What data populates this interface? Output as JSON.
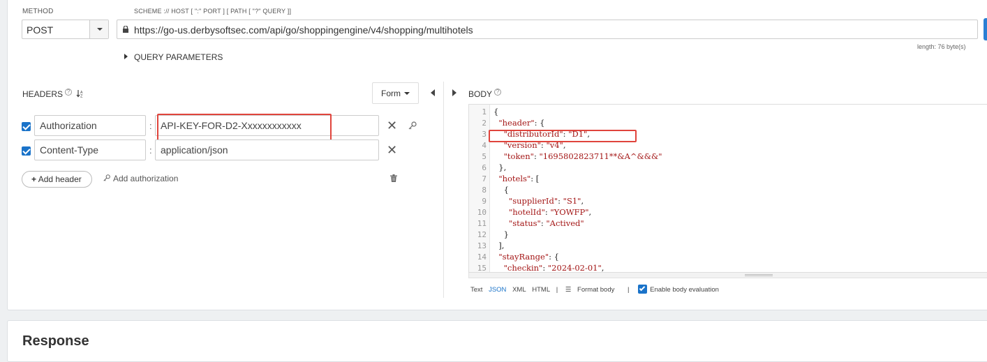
{
  "request": {
    "method_label": "METHOD",
    "method_value": "POST",
    "url_label": "SCHEME :// HOST [ \":\" PORT ] [ PATH [ \"?\" QUERY ]]",
    "url_value": "https://go-us.derbysoftsec.com/api/go/shoppingengine/v4/shopping/multihotels",
    "query_parameters_label": "QUERY PARAMETERS",
    "length_text": "length: 76 byte(s)"
  },
  "headers_panel": {
    "title": "HEADERS",
    "help_icon": "help-icon",
    "sort_icon": "sort-alpha-icon",
    "form_button": "Form",
    "rows": [
      {
        "checked": true,
        "name": "Authorization",
        "value": "API-KEY-FOR-D2-Xxxxxxxxxxxx"
      },
      {
        "checked": true,
        "name": "Content-Type",
        "value": "application/json"
      }
    ],
    "add_header": "Add header",
    "add_authorization": "Add authorization"
  },
  "body_panel": {
    "title": "BODY",
    "lines": [
      {
        "n": "1",
        "code": "{"
      },
      {
        "n": "2",
        "code": "  \"header\": {"
      },
      {
        "n": "3",
        "code": "    \"distributorId\": \"D1\","
      },
      {
        "n": "4",
        "code": "    \"version\": \"v4\","
      },
      {
        "n": "5",
        "code": "    \"token\": \"1695802823711**&A^&&&\""
      },
      {
        "n": "6",
        "code": "  },"
      },
      {
        "n": "7",
        "code": "  \"hotels\": ["
      },
      {
        "n": "8",
        "code": "    {"
      },
      {
        "n": "9",
        "code": "      \"supplierId\": \"S1\","
      },
      {
        "n": "10",
        "code": "      \"hotelId\": \"YOWFP\","
      },
      {
        "n": "11",
        "code": "      \"status\": \"Actived\""
      },
      {
        "n": "12",
        "code": "    }"
      },
      {
        "n": "13",
        "code": "  ],"
      },
      {
        "n": "14",
        "code": "  \"stayRange\": {"
      },
      {
        "n": "15",
        "code": "    \"checkin\": \"2024-02-01\","
      }
    ],
    "footer": {
      "text": "Text",
      "json": "JSON",
      "xml": "XML",
      "html": "HTML",
      "sep": "|",
      "format_body": "Format body",
      "enable_eval": "Enable body evaluation"
    }
  },
  "response_title": "Response",
  "colors": {
    "accent": "#1a73c9",
    "highlight": "#e0443c"
  }
}
